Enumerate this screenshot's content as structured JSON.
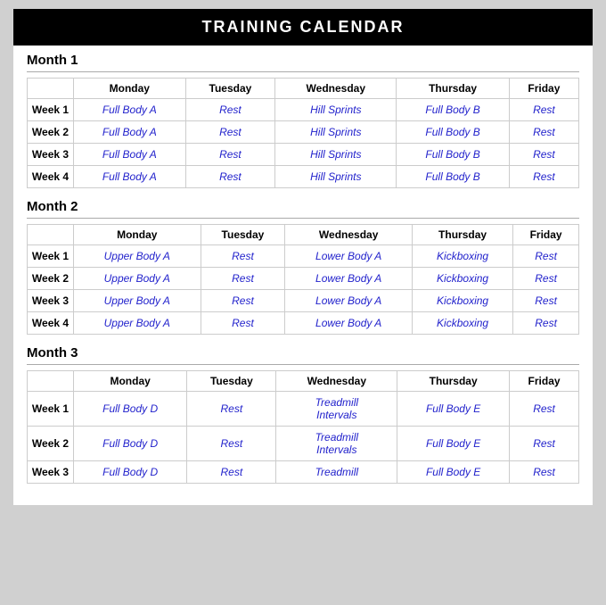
{
  "title": "TRAINING CALENDAR",
  "months": [
    {
      "label": "Month 1",
      "columns": [
        "",
        "Monday",
        "Tuesday",
        "Wednesday",
        "Thursday",
        "Friday"
      ],
      "weeks": [
        {
          "label": "Week 1",
          "monday": "Full Body A",
          "tuesday": "Rest",
          "wednesday": "Hill Sprints",
          "thursday": "Full Body B",
          "friday": "Rest"
        },
        {
          "label": "Week 2",
          "monday": "Full Body A",
          "tuesday": "Rest",
          "wednesday": "Hill Sprints",
          "thursday": "Full Body B",
          "friday": "Rest"
        },
        {
          "label": "Week 3",
          "monday": "Full Body A",
          "tuesday": "Rest",
          "wednesday": "Hill Sprints",
          "thursday": "Full Body B",
          "friday": "Rest"
        },
        {
          "label": "Week 4",
          "monday": "Full Body A",
          "tuesday": "Rest",
          "wednesday": "Hill Sprints",
          "thursday": "Full Body B",
          "friday": "Rest"
        }
      ]
    },
    {
      "label": "Month 2",
      "columns": [
        "",
        "Monday",
        "Tuesday",
        "Wednesday",
        "Thursday",
        "Friday"
      ],
      "weeks": [
        {
          "label": "Week 1",
          "monday": "Upper Body A",
          "tuesday": "Rest",
          "wednesday": "Lower Body A",
          "thursday": "Kickboxing",
          "friday": "Rest"
        },
        {
          "label": "Week 2",
          "monday": "Upper Body A",
          "tuesday": "Rest",
          "wednesday": "Lower Body A",
          "thursday": "Kickboxing",
          "friday": "Rest"
        },
        {
          "label": "Week 3",
          "monday": "Upper Body A",
          "tuesday": "Rest",
          "wednesday": "Lower Body A",
          "thursday": "Kickboxing",
          "friday": "Rest"
        },
        {
          "label": "Week 4",
          "monday": "Upper Body A",
          "tuesday": "Rest",
          "wednesday": "Lower Body A",
          "thursday": "Kickboxing",
          "friday": "Rest"
        }
      ]
    },
    {
      "label": "Month 3",
      "columns": [
        "",
        "Monday",
        "Tuesday",
        "Wednesday",
        "Thursday",
        "Friday"
      ],
      "weeks": [
        {
          "label": "Week 1",
          "monday": "Full Body D",
          "tuesday": "Rest",
          "wednesday": "Treadmill\nIntervals",
          "thursday": "Full Body E",
          "friday": "Rest"
        },
        {
          "label": "Week 2",
          "monday": "Full Body D",
          "tuesday": "Rest",
          "wednesday": "Treadmill\nIntervals",
          "thursday": "Full Body E",
          "friday": "Rest"
        },
        {
          "label": "Week 3",
          "monday": "Full Body D",
          "tuesday": "Rest",
          "wednesday": "Treadmill",
          "thursday": "Full Body E",
          "friday": "Rest"
        }
      ]
    }
  ]
}
